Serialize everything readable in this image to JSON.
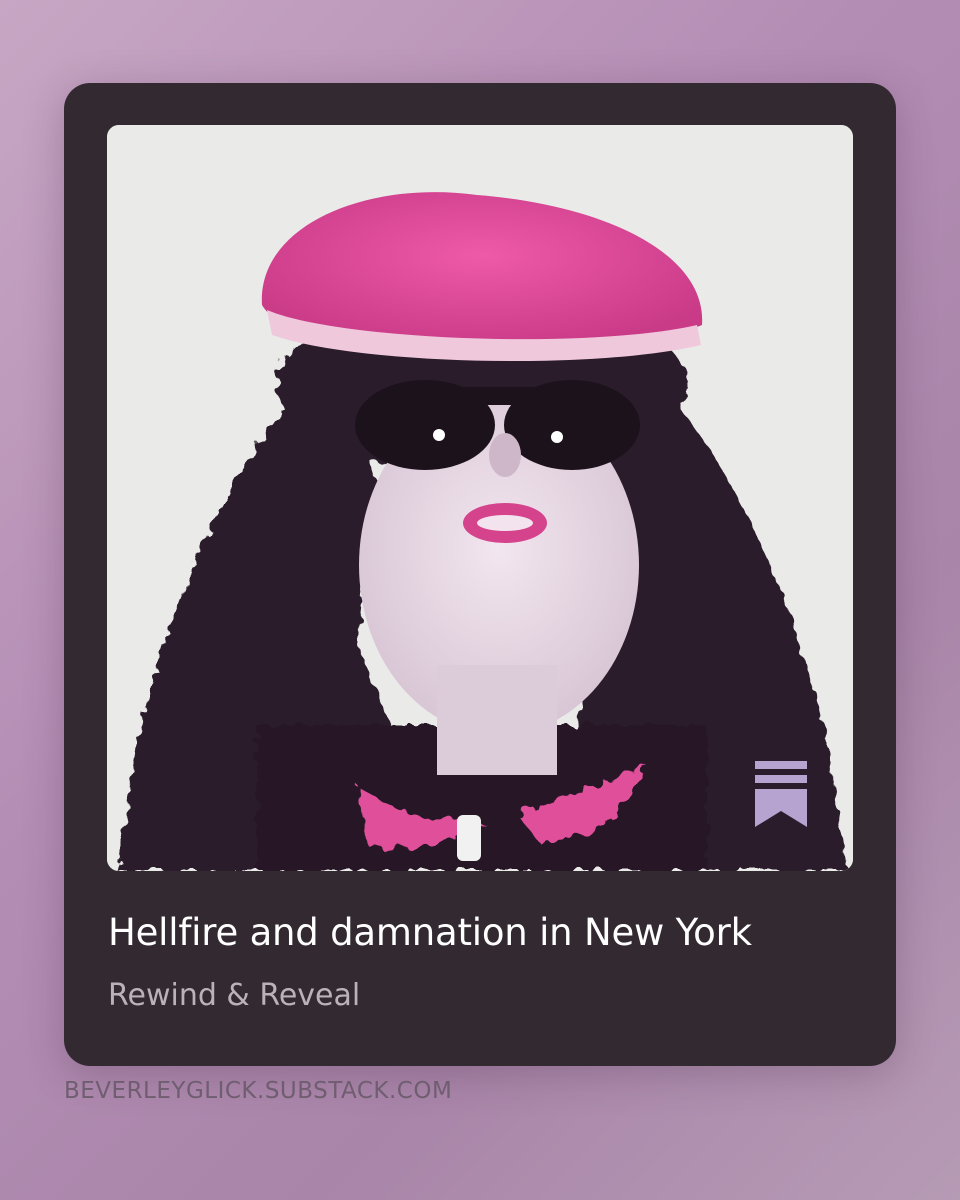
{
  "post": {
    "title": "Hellfire and damnation in New York",
    "publication": "Rewind & Reveal",
    "cover_image": "portrait-pink-cap-dark-hair-sunglasses",
    "badge_icon": "substack-bookmark-icon"
  },
  "footer": {
    "domain": "BEVERLEYGLICK.SUBSTACK.COM"
  },
  "colors": {
    "background": "#b48db4",
    "card": "#332a31",
    "title_text": "#ffffff",
    "publication_text": "#b9b2b8",
    "domain_text": "#6f5d70",
    "accent_pink": "#e0509a",
    "badge": "#b7a3cf"
  }
}
